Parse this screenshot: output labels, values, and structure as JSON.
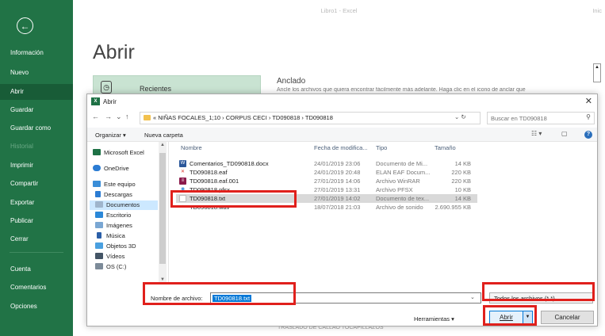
{
  "backstage": {
    "app_title": "Libro1 - Excel",
    "app_title_right": "Inic",
    "page_title": "Abrir",
    "recent_label": "Recientes",
    "pinned_label": "Anclado",
    "pinned_desc": "Ancle los archivos que quiera encontrar fácilmente más adelante. Haga clic en el icono de anclar que",
    "bottom_text": "TRASLADO DE CALLAO TOCAPILLAZOS",
    "scroll_glyph": "▲"
  },
  "rail": {
    "back_glyph": "←",
    "items": [
      {
        "label": "Información"
      },
      {
        "label": "Nuevo"
      },
      {
        "label": "Abrir"
      },
      {
        "label": "Guardar"
      },
      {
        "label": "Guardar como"
      },
      {
        "label": "Historial"
      },
      {
        "label": "Imprimir"
      },
      {
        "label": "Compartir"
      },
      {
        "label": "Exportar"
      },
      {
        "label": "Publicar"
      },
      {
        "label": "Cerrar"
      },
      {
        "label": "Cuenta"
      },
      {
        "label": "Comentarios"
      },
      {
        "label": "Opciones"
      }
    ]
  },
  "dialog": {
    "title": "Abrir",
    "title_icon_text": "X",
    "close_glyph": "✕",
    "nav": {
      "back": "←",
      "forward": "→",
      "down": "⌄",
      "up": "↑"
    },
    "address": "« NIÑAS FOCALES_1;10 › CORPUS CECI › TD090818 › TD090818",
    "address_right": "⌄  ↻",
    "search_placeholder": "Buscar en TD090818",
    "search_glyph": "⚲",
    "toolbar": {
      "organize": "Organizar ▾",
      "new_folder": "Nueva carpeta",
      "view_glyph": "☷ ▾",
      "pane_glyph": "▢",
      "help_glyph": "?"
    },
    "nav_pane": [
      {
        "label": "Microsoft Excel",
        "color": "#1e7145"
      },
      {
        "label": "OneDrive",
        "color": "#2b7cd3"
      },
      {
        "label": "Este equipo",
        "color": "#3b8ed8"
      },
      {
        "label": "Descargas",
        "color": "#2b7cd3"
      },
      {
        "label": "Documentos",
        "color": "#9fb5cc"
      },
      {
        "label": "Escritorio",
        "color": "#2b88d8"
      },
      {
        "label": "Imágenes",
        "color": "#7aa7d3"
      },
      {
        "label": "Música",
        "color": "#2b5fa8"
      },
      {
        "label": "Objetos 3D",
        "color": "#4aa0e0"
      },
      {
        "label": "Vídeos",
        "color": "#445566"
      },
      {
        "label": "OS (C:)",
        "color": "#7d8b99"
      }
    ],
    "columns": {
      "name": "Nombre",
      "date": "Fecha de modifica...",
      "type": "Tipo",
      "size": "Tamaño"
    },
    "files": [
      {
        "name": "Comentarios_TD090818.docx",
        "date": "24/01/2019 23:06",
        "type": "Documento de Mi...",
        "size": "14 KB",
        "icon": "W",
        "color": "#2b579a"
      },
      {
        "name": "TD090818.eaf",
        "date": "24/01/2019 20:48",
        "type": "ELAN EAF Docum...",
        "size": "220 KB",
        "icon": "✕",
        "color": "#d9352b"
      },
      {
        "name": "TD090818.eaf.001",
        "date": "27/01/2019 14:06",
        "type": "Archivo WinRAR",
        "size": "220 KB",
        "icon": "≡",
        "color": "#8b1a4b"
      },
      {
        "name": "TD090818.pfsx",
        "date": "27/01/2019 13:31",
        "type": "Archivo PFSX",
        "size": "10 KB",
        "icon": "◉",
        "color": "#3a8fd8"
      },
      {
        "name": "TD090818.txt",
        "date": "27/01/2019 14:02",
        "type": "Documento de tex...",
        "size": "14 KB",
        "icon": "",
        "color": "#bbbbbb"
      },
      {
        "name": "TD090818.wav",
        "date": "18/07/2018 21:03",
        "type": "Archivo de sonido",
        "size": "2.690.955 KB",
        "icon": "♪",
        "color": "#6a8fb5"
      }
    ],
    "filename_label": "Nombre de archivo:",
    "filename_value": "TD090818.txt",
    "filename_drop": "⌄",
    "filter_value": "Todos los archivos (*.*)",
    "filter_chev": "⌄",
    "tools_label": "Herramientas ▾",
    "open_label": "Abrir",
    "open_split": "▼",
    "cancel_label": "Cancelar"
  }
}
